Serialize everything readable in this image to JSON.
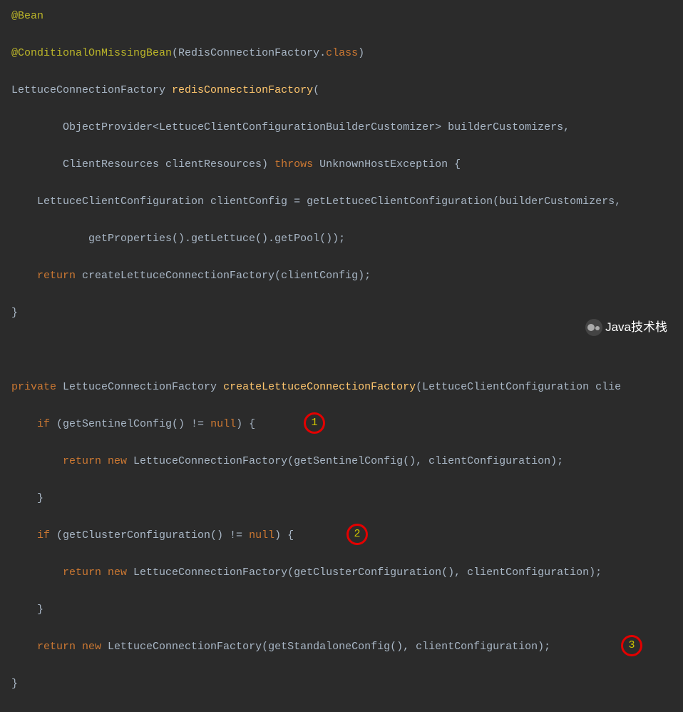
{
  "code": {
    "l1_annotation": "@Bean",
    "l2_annotation": "@ConditionalOnMissingBean",
    "l2_open": "(RedisConnectionFactory.",
    "l2_class": "class",
    "l2_close": ")",
    "l3_type": "LettuceConnectionFactory ",
    "l3_method": "redisConnectionFactory",
    "l3_open": "(",
    "l4": "        ObjectProvider<LettuceClientConfigurationBuilderCustomizer> builderCustomizers,",
    "l5_a": "        ClientResources clientResources) ",
    "l5_throws": "throws",
    "l5_b": " UnknownHostException {",
    "l6": "    LettuceClientConfiguration clientConfig = getLettuceClientConfiguration(builderCustomizers,",
    "l7": "            getProperties().getLettuce().getPool());",
    "l8_return": "    return",
    "l8_rest": " createLettuceConnectionFactory(clientConfig);",
    "l9": "}",
    "l11_private": "private",
    "l11_type": " LettuceConnectionFactory ",
    "l11_method": "createLettuceConnectionFactory",
    "l11_params": "(LettuceClientConfiguration clie",
    "l12_if": "    if",
    "l12_cond_a": " (getSentinelConfig() != ",
    "l12_null": "null",
    "l12_cond_b": ") {",
    "l13_return": "        return new",
    "l13_rest": " LettuceConnectionFactory(getSentinelConfig(), clientConfiguration);",
    "l14": "    }",
    "l15_if": "    if",
    "l15_cond_a": " (getClusterConfiguration() != ",
    "l15_null": "null",
    "l15_cond_b": ") {",
    "l16_return": "        return new",
    "l16_rest": " LettuceConnectionFactory(getClusterConfiguration(), clientConfiguration);",
    "l17": "    }",
    "l18_return": "    return new",
    "l18_rest": " LettuceConnectionFactory(getStandaloneConfig(), clientConfiguration);",
    "l19": "}"
  },
  "badges": {
    "b1": "1",
    "b2": "2",
    "b3": "3"
  },
  "watermark": "Java技术栈"
}
